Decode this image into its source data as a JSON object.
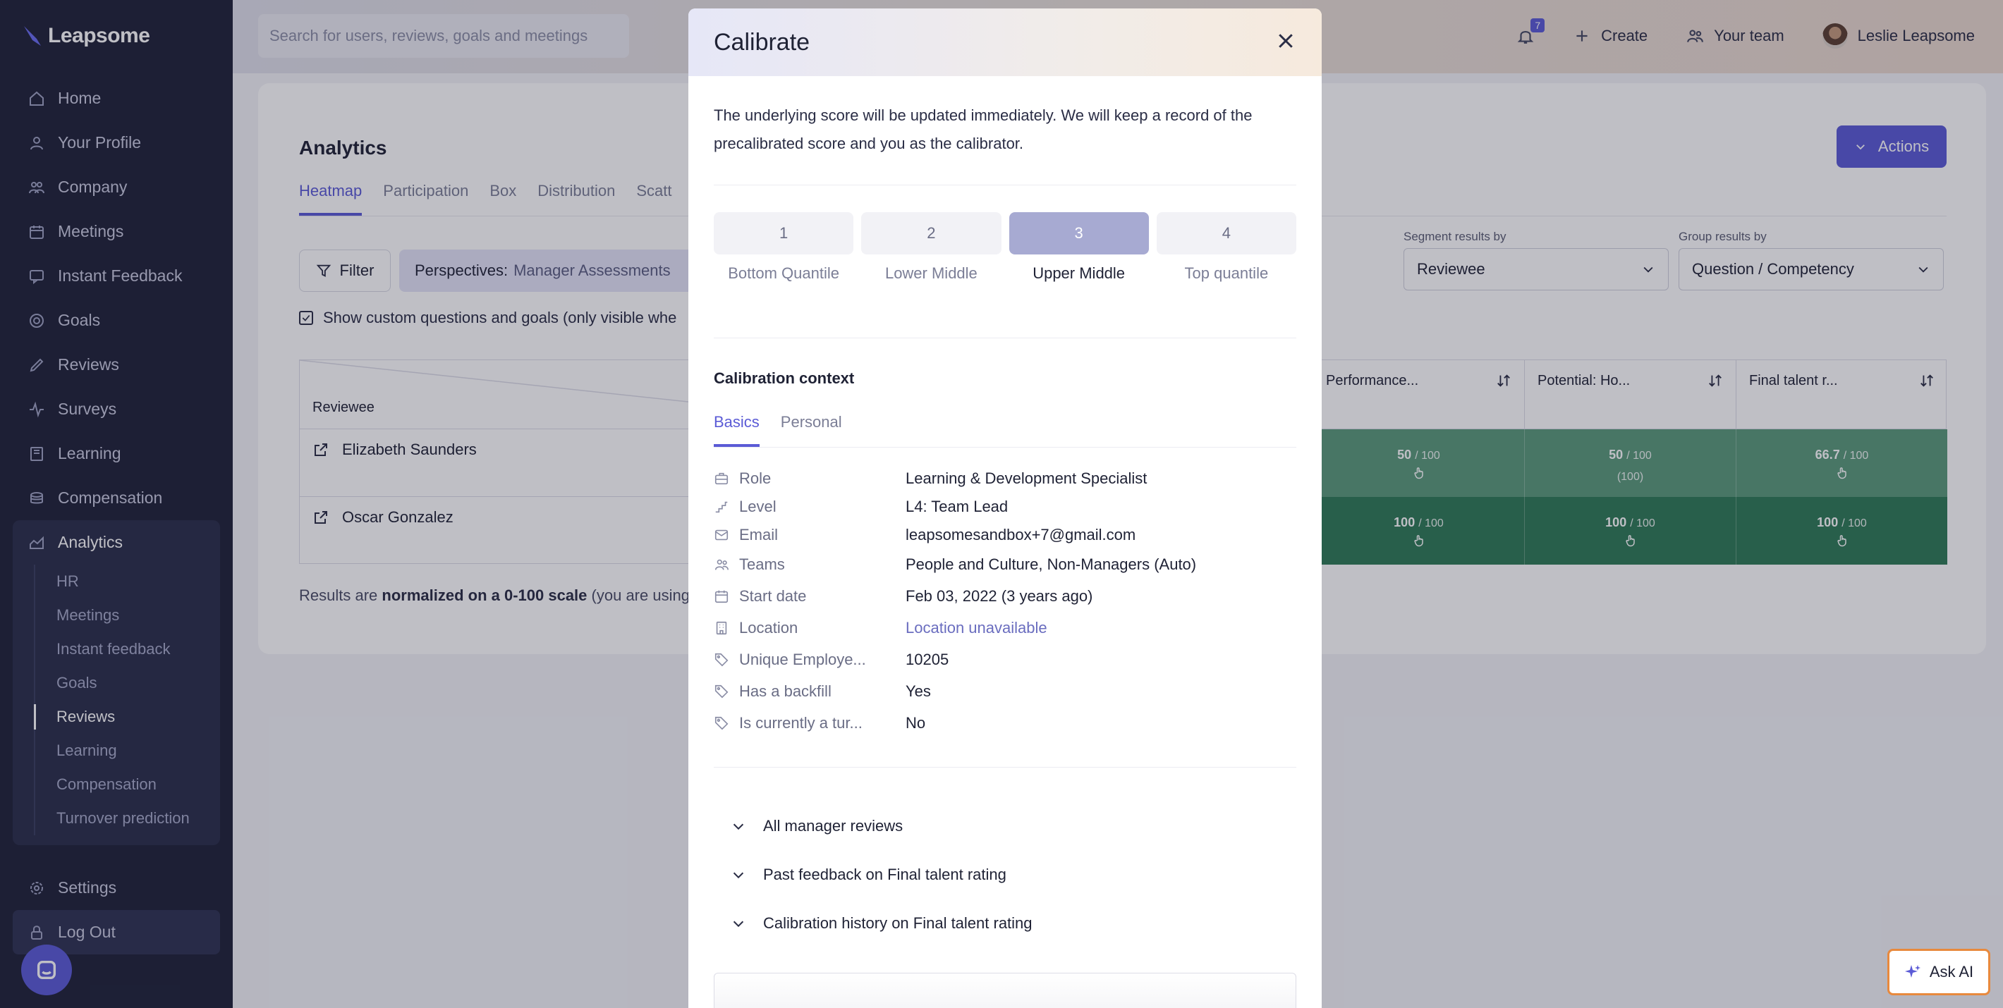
{
  "app": {
    "logo_text": "Leapsome"
  },
  "sidebar": {
    "items": [
      {
        "label": "Home",
        "icon": "home-icon"
      },
      {
        "label": "Your Profile",
        "icon": "user-icon"
      },
      {
        "label": "Company",
        "icon": "company-icon"
      },
      {
        "label": "Meetings",
        "icon": "calendar-icon"
      },
      {
        "label": "Instant Feedback",
        "icon": "feedback-icon"
      },
      {
        "label": "Goals",
        "icon": "target-icon"
      },
      {
        "label": "Reviews",
        "icon": "pen-icon"
      },
      {
        "label": "Surveys",
        "icon": "pulse-icon"
      },
      {
        "label": "Learning",
        "icon": "book-icon"
      },
      {
        "label": "Compensation",
        "icon": "coins-icon"
      }
    ],
    "analytics": {
      "label": "Analytics",
      "sub_items": [
        "HR",
        "Meetings",
        "Instant feedback",
        "Goals",
        "Reviews",
        "Learning",
        "Compensation",
        "Turnover prediction"
      ],
      "active_sub": "Reviews"
    },
    "settings_label": "Settings",
    "logout_label": "Log Out"
  },
  "topbar": {
    "search_placeholder": "Search for users, reviews, goals and meetings",
    "notification_count": "7",
    "create_label": "Create",
    "team_label": "Your team",
    "user_name": "Leslie Leapsome"
  },
  "analytics": {
    "title": "Analytics",
    "actions_label": "Actions",
    "tabs": [
      "Heatmap",
      "Participation",
      "Box",
      "Distribution",
      "Scatt"
    ],
    "active_tab": "Heatmap",
    "filter_label": "Filter",
    "perspective_key": "Perspectives:",
    "perspective_value": "Manager Assessments",
    "segment_label": "Segment results by",
    "segment_value": "Reviewee",
    "group_label": "Group results by",
    "group_value": "Question / Competency",
    "checkbox_label": "Show custom questions and goals (only visible whe",
    "table": {
      "reviewee_header": "Reviewee",
      "columns": [
        "Performance...",
        "Potential: Ho...",
        "Final talent r..."
      ],
      "rows": [
        {
          "name": "Elizabeth Saunders",
          "cells": [
            {
              "score": "50",
              "max": "/ 100",
              "extra": ""
            },
            {
              "score": "50",
              "max": "/ 100",
              "extra": "(100)"
            },
            {
              "score": "66.7",
              "max": "/ 100",
              "extra": ""
            }
          ],
          "color": "#5b9a7b"
        },
        {
          "name": "Oscar Gonzalez",
          "cells": [
            {
              "score": "100",
              "max": "/ 100",
              "extra": ""
            },
            {
              "score": "100",
              "max": "/ 100",
              "extra": ""
            },
            {
              "score": "100",
              "max": "/ 100",
              "extra": ""
            }
          ],
          "color": "#2f7a56"
        }
      ]
    },
    "note_prefix": "Results are ",
    "note_bold": "normalized on a 0-100 scale",
    "note_suffix": " (you are using"
  },
  "modal": {
    "title": "Calibrate",
    "description": "The underlying score will be updated immediately. We will keep a record of the precalibrated score and you as the calibrator.",
    "scale": [
      {
        "value": "1",
        "label": "Bottom Quantile"
      },
      {
        "value": "2",
        "label": "Lower Middle"
      },
      {
        "value": "3",
        "label": "Upper Middle"
      },
      {
        "value": "4",
        "label": "Top quantile"
      }
    ],
    "selected_value": "3",
    "context_title": "Calibration context",
    "context_tabs": [
      "Basics",
      "Personal"
    ],
    "active_context_tab": "Basics",
    "facts": [
      {
        "key": "Role",
        "value": "Learning & Development Specialist",
        "icon": "briefcase-icon"
      },
      {
        "key": "Level",
        "value": "L4: Team Lead",
        "icon": "stairs-icon"
      },
      {
        "key": "Email",
        "value": "leapsomesandbox+7@gmail.com",
        "icon": "mail-icon"
      },
      {
        "key": "Teams",
        "value": "People and Culture, Non-Managers (Auto)",
        "icon": "team-icon"
      },
      {
        "key": "Start date",
        "value": "Feb 03, 2022 (3 years ago)",
        "icon": "calendar-icon"
      },
      {
        "key": "Location",
        "value": "Location unavailable",
        "icon": "building-icon"
      },
      {
        "key": "Unique Employe...",
        "value": "10205",
        "icon": "tag-icon"
      },
      {
        "key": "Has a backfill",
        "value": "Yes",
        "icon": "tag-icon"
      },
      {
        "key": "Is currently a tur...",
        "value": "No",
        "icon": "tag-icon"
      }
    ],
    "accordions": [
      "All manager reviews",
      "Past feedback on Final talent rating",
      "Calibration history on Final talent rating"
    ]
  },
  "ask_ai_label": "Ask AI"
}
